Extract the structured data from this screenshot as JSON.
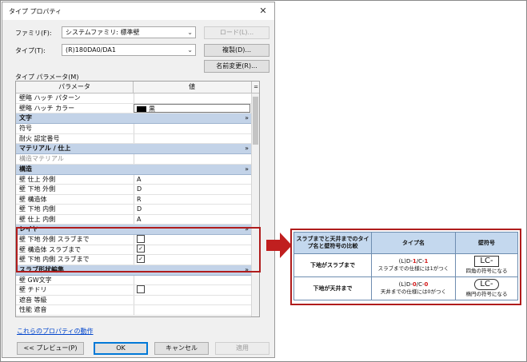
{
  "dialog": {
    "title": "タイプ プロパティ",
    "close_glyph": "✕",
    "family_label": "ファミリ(F):",
    "family_value": "システムファミリ: 標準壁",
    "type_label": "タイプ(T):",
    "type_value": "(R)180DA0/DA1",
    "load_button": "ロード(L)...",
    "duplicate_button": "複製(D)...",
    "rename_button": "名前変更(R)...",
    "params_label": "タイプ パラメータ(M)",
    "col_param": "パラメータ",
    "col_value": "値",
    "col_eq": "=",
    "rows_top": [
      {
        "param": "壁略 ハッチ パターン",
        "value": ""
      },
      {
        "param": "壁略 ハッチ カラー",
        "value": "黒"
      }
    ],
    "group_text": "文字",
    "rows_text": [
      {
        "param": "符号",
        "value": ""
      },
      {
        "param": "耐火 認定番号",
        "value": ""
      }
    ],
    "group_material": "マテリアル / 仕上",
    "rows_material": [
      {
        "param": "構造マテリアル",
        "value": ""
      }
    ],
    "group_structure": "構造",
    "rows_structure": [
      {
        "param": "壁 仕上 外側",
        "value": "A"
      },
      {
        "param": "壁 下地 外側",
        "value": "D"
      },
      {
        "param": "壁 構造体",
        "value": "R"
      },
      {
        "param": "壁 下地 内側",
        "value": "D"
      },
      {
        "param": "壁 仕上 内側",
        "value": "A"
      }
    ],
    "group_layer": "レイヤ",
    "rows_layer": [
      {
        "param": "壁 下地 外側 スラブまで",
        "checked": false
      },
      {
        "param": "壁 構造体 スラブまで",
        "checked": true
      },
      {
        "param": "壁 下地 内側 スラブまで",
        "checked": true
      }
    ],
    "group_slab": "スラブ形状編集",
    "rows_bottom": [
      {
        "param": "壁 GW文字",
        "value": ""
      },
      {
        "param": "壁 チドリ",
        "value": ""
      },
      {
        "param": "遮音 等級",
        "value": ""
      },
      {
        "param": "性能 遮音",
        "value": ""
      }
    ],
    "collapse_glyph": "»",
    "check_glyph": "✓",
    "link": "これらのプロパティの動作",
    "preview_button": "<< プレビュー(P)",
    "ok_button": "OK",
    "cancel_button": "キャンセル",
    "apply_button": "適用"
  },
  "comparison": {
    "header_col1": "スラブまでと天井までのタイプ名と壁符号の比較",
    "header_col2": "タイプ名",
    "header_col3": "壁符号",
    "row1_label": "下地がスラブまで",
    "row1_type_prefix": "(L)D-",
    "row1_type_a": "1",
    "row1_type_sep": "/C-",
    "row1_type_b": "1",
    "row1_type_note": "スラブまでの仕様には1がつく",
    "row1_symbol": "LC-",
    "row1_symbol_note": "四角の符号になる",
    "row2_label": "下地が天井まで",
    "row2_type_prefix": "(L)D-",
    "row2_type_a": "0",
    "row2_type_sep": "/C-",
    "row2_type_b": "0",
    "row2_type_note": "天井までの仕様には0がつく",
    "row2_symbol": "LC-",
    "row2_symbol_note": "楕円の符号になる"
  },
  "colors": {
    "highlight_red": "#b01c1c",
    "group_band": "#c3d3e8",
    "table_header": "#c4d8ee",
    "digit_red": "#d41a1a"
  }
}
